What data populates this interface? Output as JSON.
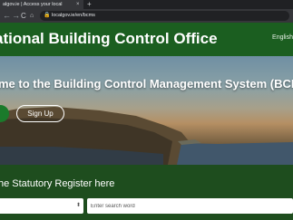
{
  "browser": {
    "tab_title": "algov.ie | Access your local",
    "tab_close": "×",
    "new_tab": "+",
    "url": "localgov.ie/en/bcms",
    "back": "←",
    "forward": "→",
    "reload": "C",
    "home": "⌂",
    "lock": "🔒"
  },
  "header": {
    "title": "ational Building Control Office",
    "language": "English"
  },
  "hero": {
    "title": "me to the Building Control Management System (BCMS)",
    "signup_label": "Sign Up"
  },
  "register": {
    "title": "he Statutory Register here",
    "select_arrow": "⬍",
    "search_placeholder": "Enter search word"
  }
}
